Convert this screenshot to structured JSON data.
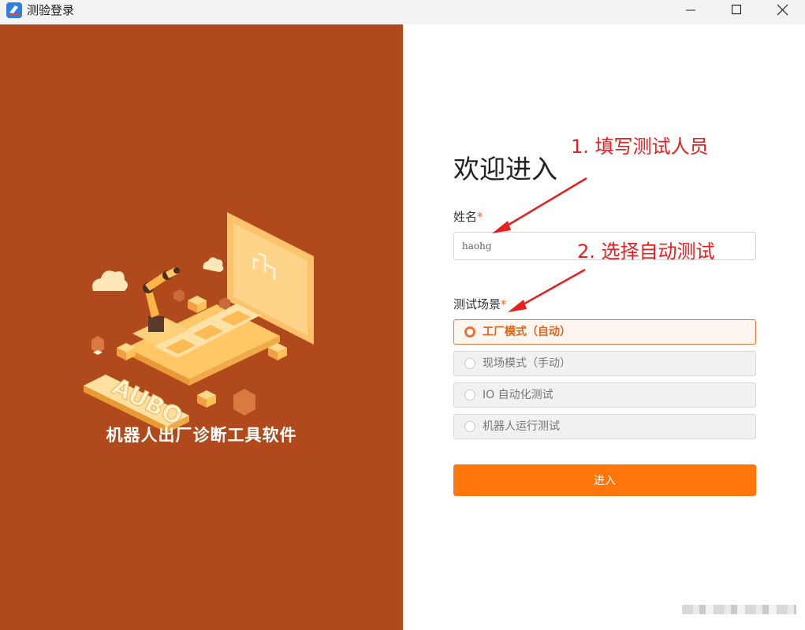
{
  "window": {
    "title": "测验登录"
  },
  "left": {
    "caption": "机器人出厂诊断工具软件",
    "logo_text": "AUBO"
  },
  "form": {
    "welcome": "欢迎进入",
    "name_label": "姓名",
    "name_value": "haohg",
    "required_mark": "*",
    "scene_label": "测试场景",
    "options": [
      {
        "label": "工厂模式（自动）",
        "selected": true
      },
      {
        "label": "现场模式（手动）",
        "selected": false
      },
      {
        "label": "IO 自动化测试",
        "selected": false
      },
      {
        "label": "机器人运行测试",
        "selected": false
      }
    ],
    "submit_label": "进入"
  },
  "annotations": {
    "step1": "1. 填写测试人员",
    "step2": "2. 选择自动测试"
  },
  "colors": {
    "left_panel": "#b04a1c",
    "accent": "#ff760b",
    "annotation": "#e81f1f"
  }
}
